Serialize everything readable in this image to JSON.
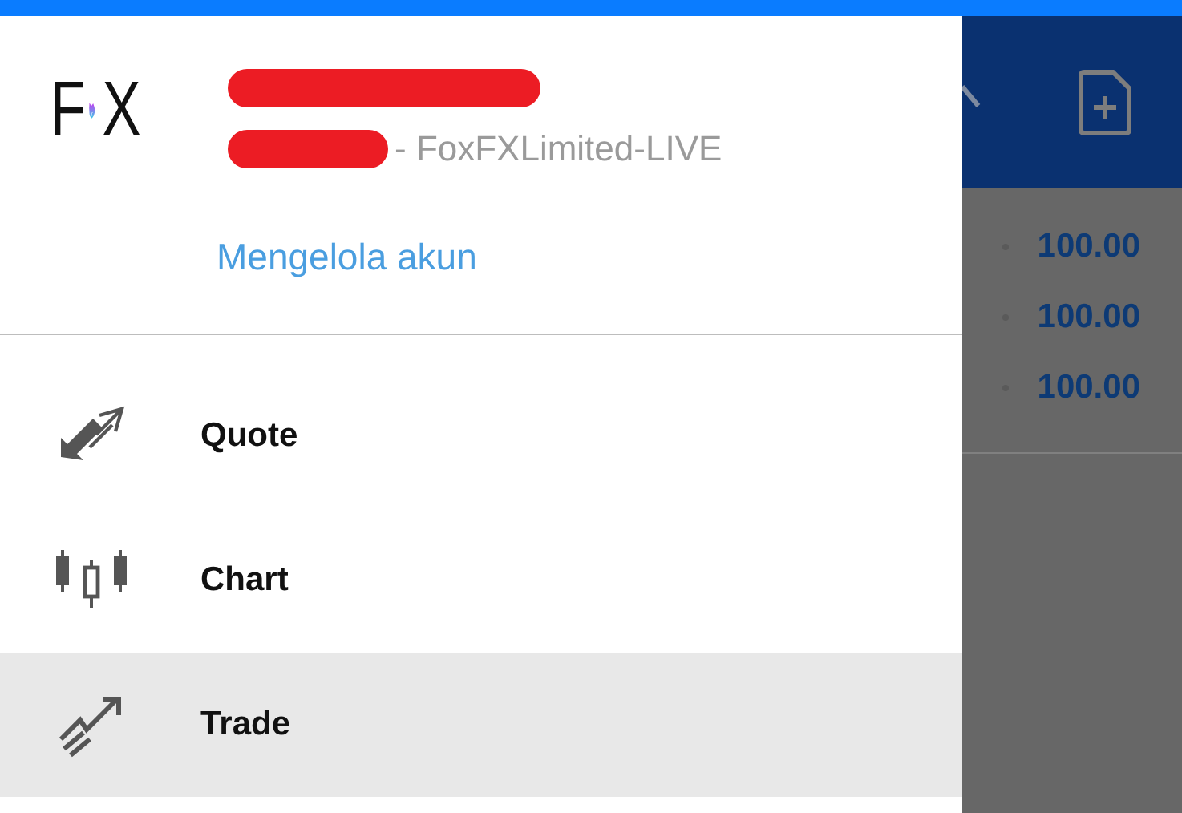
{
  "drawer": {
    "logo": {
      "left": "F",
      "right": "X"
    },
    "server": "- FoxFXLimited-LIVE",
    "manage_link": "Mengelola akun",
    "menu": [
      {
        "label": "Quote",
        "selected": false
      },
      {
        "label": "Chart",
        "selected": false
      },
      {
        "label": "Trade",
        "selected": true
      }
    ]
  },
  "background": {
    "values": [
      "100.00",
      "100.00",
      "100.00"
    ]
  }
}
